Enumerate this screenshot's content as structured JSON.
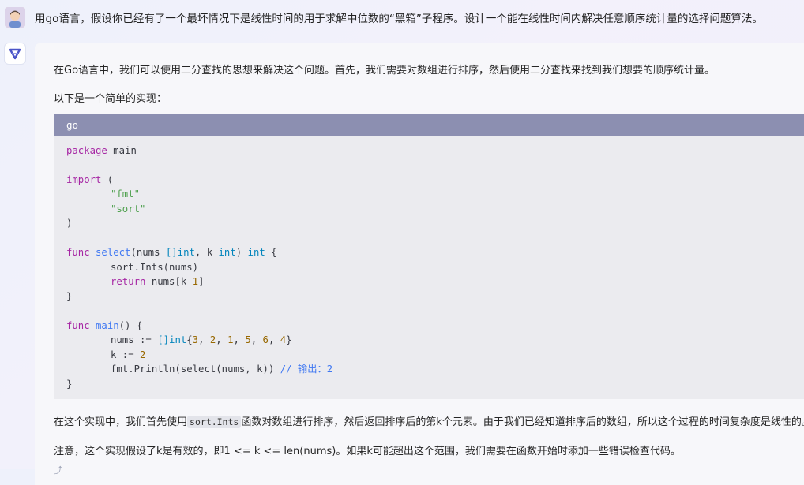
{
  "question": "用go语言，假设你已经有了一个最坏情况下是线性时间的用于求解中位数的“黑箱”子程序。设计一个能在线性时间内解决任意顺序统计量的选择问题算法。",
  "answer": {
    "p1": "在Go语言中，我们可以使用二分查找的思想来解决这个问题。首先，我们需要对数组进行排序，然后使用二分查找来找到我们想要的顺序统计量。",
    "p2": "以下是一个简单的实现：",
    "code_lang": "go",
    "code": {
      "l1a": "package",
      "l1b": " main",
      "l3a": "import",
      "l3b": " (",
      "l4": "\"fmt\"",
      "l5": "\"sort\"",
      "l6": ")",
      "l8_kw": "func",
      "l8_fn": "select",
      "l8_p1": "(nums ",
      "l8_p2": "[]int",
      "l8_p3": ", k ",
      "l8_p4": "int",
      "l8_p5": ") ",
      "l8_p6": "int",
      "l8_p7": " {",
      "l9": "sort.Ints(nums)",
      "l10_kw": "return",
      "l10_a": " nums[k-",
      "l10_n": "1",
      "l10_b": "]",
      "l11": "}",
      "l13_kw": "func",
      "l13_fn": "main",
      "l13_b": "() {",
      "l14_a": "nums := ",
      "l14_t": "[]int",
      "l14_b": "{",
      "l14_n1": "3",
      "l14_n2": "2",
      "l14_n3": "1",
      "l14_n4": "5",
      "l14_n5": "6",
      "l14_n6": "4",
      "l14_c": "}",
      "l15_a": "k := ",
      "l15_n": "2",
      "l16_a": "fmt.Println(select(nums, k)) ",
      "l16_c": "// 输出：2",
      "l17": "}"
    },
    "p3_a": "在这个实现中，我们首先使用",
    "p3_code": "sort.Ints",
    "p3_b": "函数对数组进行排序，然后返回排序后的第k个元素。由于我们已经知道排序后的数组，所以这个过程的时间复杂度是线性的。",
    "p4": "注意，这个实现假设了k是有效的，即1 <= k <= len(nums)。如果k可能超出这个范围，我们需要在函数开始时添加一些错误检查代码。"
  }
}
